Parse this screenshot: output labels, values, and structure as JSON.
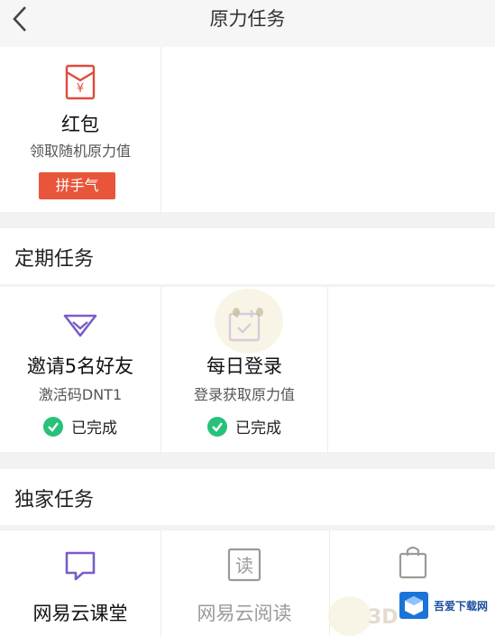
{
  "header": {
    "title": "原力任务"
  },
  "top_card": {
    "title": "红包",
    "subtitle": "领取随机原力值",
    "button_label": "拼手气"
  },
  "regular": {
    "section_title": "定期任务",
    "items": [
      {
        "title": "邀请5名好友",
        "subtitle": "激活码DNT1",
        "status": "已完成"
      },
      {
        "title": "每日登录",
        "subtitle": "登录获取原力值",
        "status": "已完成"
      }
    ]
  },
  "exclusive": {
    "section_title": "独家任务",
    "items": [
      {
        "title": "网易云课堂"
      },
      {
        "title": "网易云阅读"
      }
    ]
  },
  "watermark": {
    "badge_text": "吾爱下载网",
    "small_text": "3D"
  },
  "colors": {
    "accent_red": "#e8553a",
    "purple": "#7b5cc9",
    "success_green": "#28c17a"
  }
}
